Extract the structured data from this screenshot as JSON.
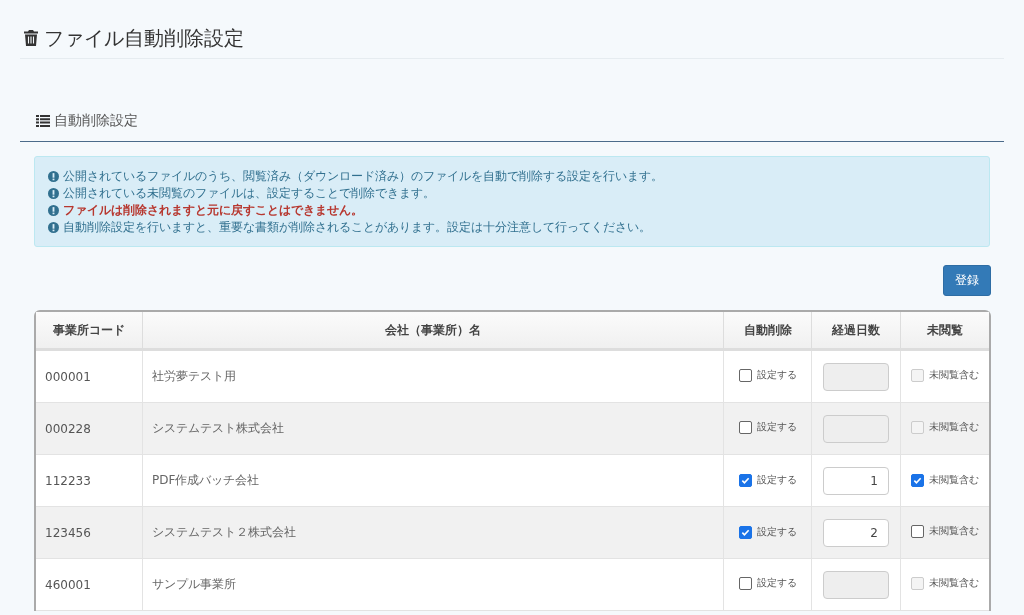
{
  "page": {
    "title": "ファイル自動削除設定"
  },
  "section": {
    "title": "自動削除設定"
  },
  "notices": [
    {
      "text": "公開されているファイルのうち、閲覧済み（ダウンロード済み）のファイルを自動で削除する設定を行います。",
      "important": false
    },
    {
      "text": "公開されている未閲覧のファイルは、設定することで削除できます。",
      "important": false
    },
    {
      "text": "ファイルは削除されますと元に戻すことはできません。",
      "important": true
    },
    {
      "text": "自動削除設定を行いますと、重要な書類が削除されることがあります。設定は十分注意して行ってください。",
      "important": false
    }
  ],
  "register_button": "登録",
  "table": {
    "columns": [
      "事業所コード",
      "会社（事業所）名",
      "自動削除",
      "経過日数",
      "未閲覧"
    ],
    "rows": [
      {
        "code": "000001",
        "name": "社労夢テスト用",
        "auto_delete": {
          "label": "設定する",
          "checked": false
        },
        "days": {
          "disabled": true
        },
        "unread": {
          "label": "未閲覧含む",
          "checked": false,
          "disabled": true
        }
      },
      {
        "code": "000228",
        "name": "システムテスト株式会社",
        "auto_delete": {
          "label": "設定する",
          "checked": false
        },
        "days": {
          "disabled": true
        },
        "unread": {
          "label": "未閲覧含む",
          "checked": false,
          "disabled": true
        }
      },
      {
        "code": "112233",
        "name": "PDF作成バッチ会社",
        "auto_delete": {
          "label": "設定する",
          "checked": true
        },
        "days": {
          "value": "1",
          "disabled": false
        },
        "unread": {
          "label": "未閲覧含む",
          "checked": true,
          "disabled": false
        }
      },
      {
        "code": "123456",
        "name": "システムテスト２株式会社",
        "auto_delete": {
          "label": "設定する",
          "checked": true
        },
        "days": {
          "value": "2",
          "disabled": false
        },
        "unread": {
          "label": "未閲覧含む",
          "checked": false,
          "disabled": false
        }
      },
      {
        "code": "460001",
        "name": "サンプル事業所",
        "auto_delete": {
          "label": "設定する",
          "checked": false
        },
        "days": {
          "disabled": true
        },
        "unread": {
          "label": "未閲覧含む",
          "checked": false,
          "disabled": true
        }
      }
    ]
  }
}
